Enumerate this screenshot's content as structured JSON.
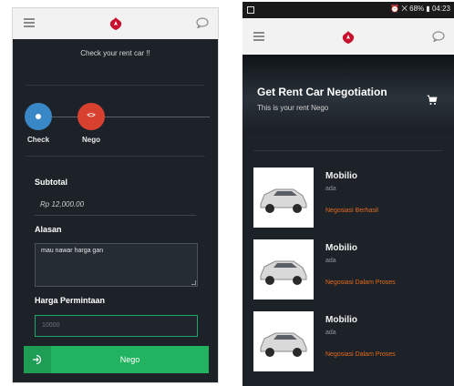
{
  "left": {
    "header_title": "Check your rent car !!",
    "steps": [
      {
        "label": "Check",
        "color": "#3a87c8"
      },
      {
        "label": "Nego",
        "color": "#d9412f",
        "symbol": "<>"
      }
    ],
    "subtotal_label": "Subtotal",
    "subtotal_value": "Rp 12,000.00",
    "alasan_label": "Alasan",
    "alasan_value": "mau nawar harga gan",
    "harga_label": "Harga Permintaan",
    "harga_placeholder": "10000",
    "nego_button": "Nego"
  },
  "right": {
    "status_bar": "⏰ ⨉ 68% ▮ 04:23",
    "hero_title": "Get Rent Car Negotiation",
    "hero_subtitle": "This is your rent Nego",
    "items": [
      {
        "name": "Mobilio",
        "desc": "ada",
        "status": "Negosiasi Berhasil"
      },
      {
        "name": "Mobilio",
        "desc": "ada",
        "status": "Negosiasi Dalam Proses"
      },
      {
        "name": "Mobilio",
        "desc": "ada",
        "status": "Negosiasi Dalam Proses"
      }
    ]
  },
  "colors": {
    "brand": "#c8102e",
    "dark_bg": "#1d2228",
    "accent_green": "#22b361",
    "status_orange": "#e56a1e"
  },
  "icons": [
    "menu-icon",
    "brand-logo-icon",
    "chat-bubble-icon",
    "login-icon",
    "cart-icon",
    "gallery-icon"
  ]
}
